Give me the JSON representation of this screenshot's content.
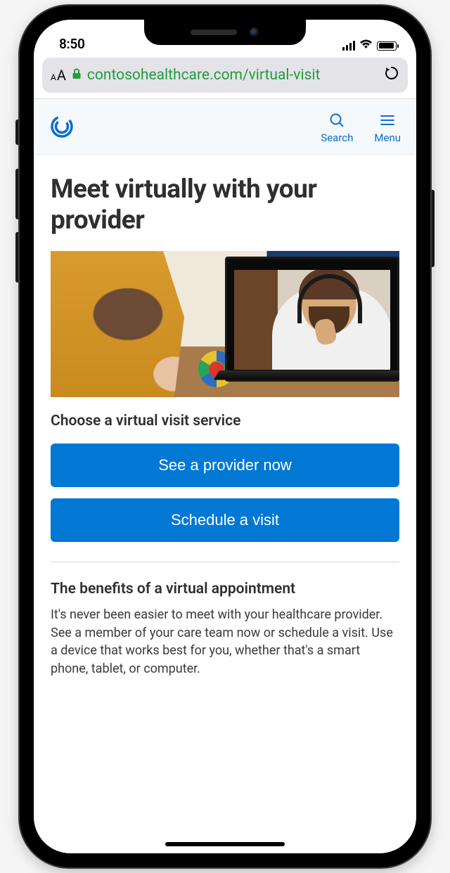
{
  "status_bar": {
    "time": "8:50"
  },
  "browser": {
    "url": "contosohealthcare.com/virtual-visit"
  },
  "header": {
    "search_label": "Search",
    "menu_label": "Menu"
  },
  "main": {
    "title": "Meet virtually with your provider",
    "choose_label": "Choose a virtual visit service",
    "cta_primary": "See a provider now",
    "cta_secondary": "Schedule a visit",
    "benefits_title": "The benefits of a virtual appointment",
    "benefits_body": "It's never been easier to meet with your healthcare provider. See a member of your care team now or schedule a visit. Use a device that works best for you, whether that's a smart phone, tablet, or computer."
  },
  "colors": {
    "accent": "#0078d4",
    "link": "#0a6ed1",
    "url_green": "#1f9d3d"
  }
}
